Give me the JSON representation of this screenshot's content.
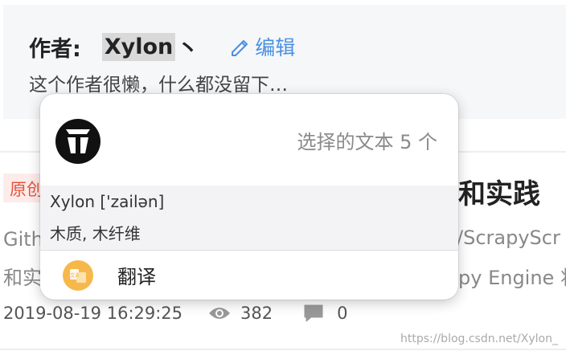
{
  "author": {
    "label": "作者:",
    "name": "Xylon",
    "name_suffix": "丶",
    "edit_label": "编辑",
    "description": "这个作者很懒，什么都没留下…"
  },
  "article": {
    "badge": "原创",
    "title_tail": "和实践",
    "desc_left_line1": "Gith",
    "desc_left_line2": "和实",
    "desc_right_line1": "/ScrapyScr",
    "desc_right_line2": "py Engine 将",
    "date": "2019-08-19 16:29:25",
    "views": "382",
    "comments": "0",
    "watermark": "https://blog.csdn.net/Xylon_"
  },
  "popup": {
    "selected_count": "选择的文本 5 个",
    "dict_word": "Xylon ['zailən]",
    "dict_meaning": "木质, 木纤维",
    "action_label": "翻译",
    "translate_icon_text": "文A"
  },
  "colors": {
    "accent": "#4a90e2",
    "badge_text": "#e5533d",
    "badge_bg": "#fdecea",
    "translate_icon": "#f7b84b"
  },
  "icons": [
    "pencil-icon",
    "popclip-logo-icon",
    "translate-icon",
    "eye-icon",
    "comment-icon"
  ]
}
